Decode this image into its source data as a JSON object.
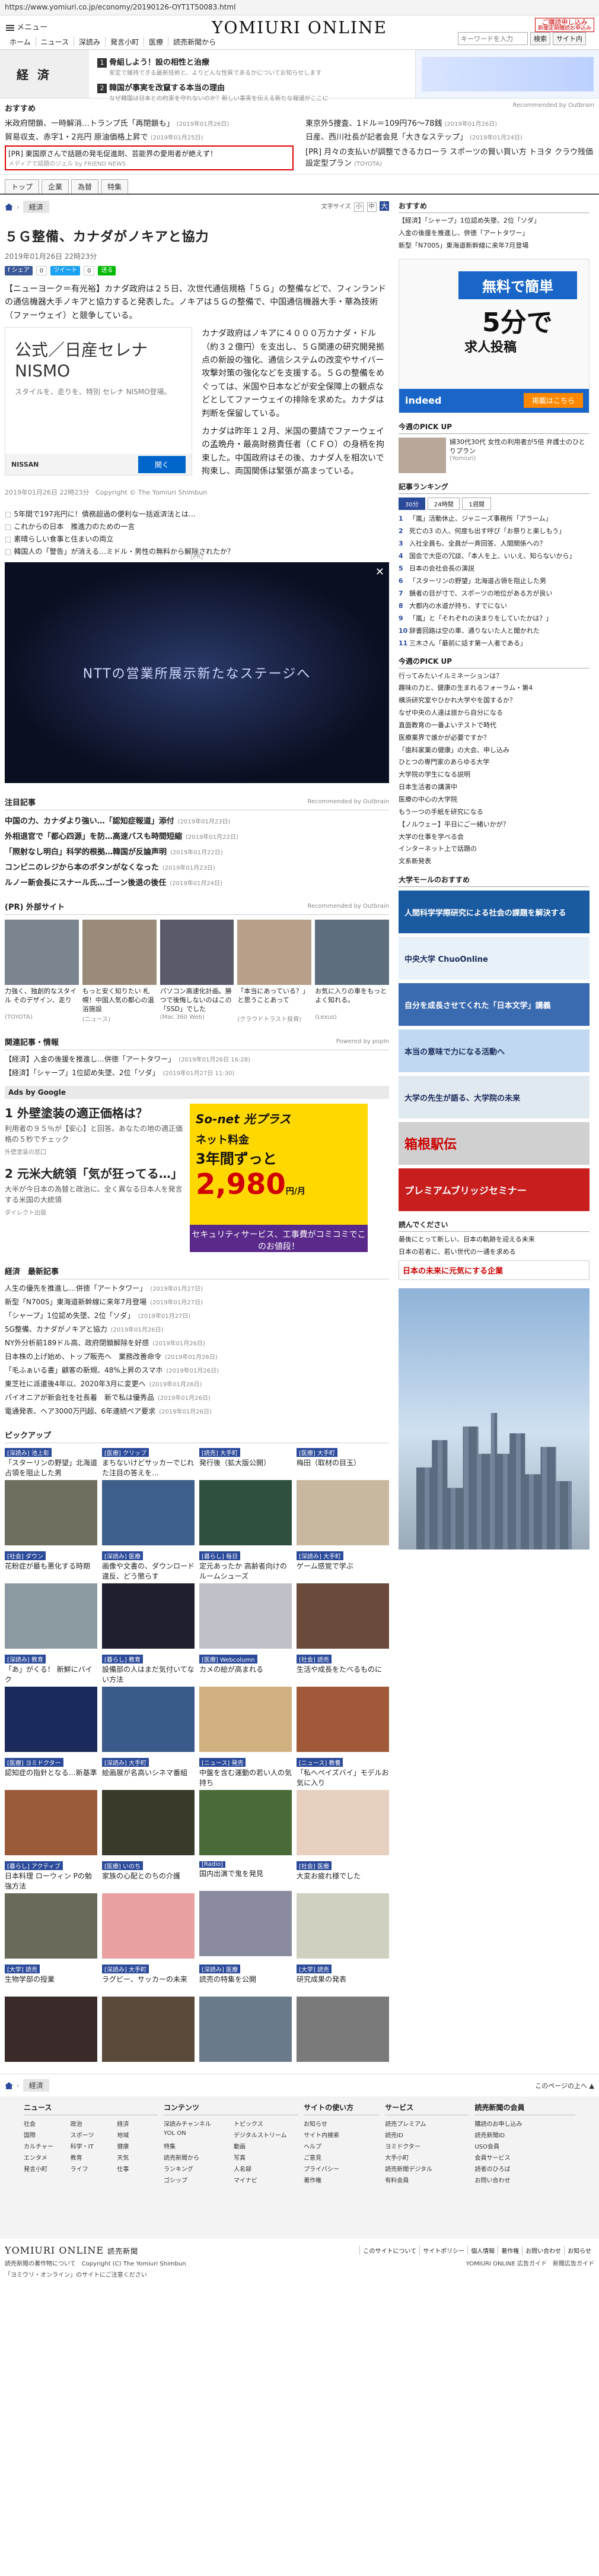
{
  "browser": {
    "url": "https://www.yomiuri.co.jp/economy/20190126-OYT1T50083.html"
  },
  "header": {
    "menu_label": "メニュー",
    "logo": "YOMIURI ONLINE",
    "nav": [
      "ホーム",
      "ニュース",
      "深読み",
      "発言小町",
      "医療",
      "読売新聞から"
    ],
    "ad_badge_line1": "ご購読申し込み",
    "ad_badge_line2": "新聞定期購読お申込み",
    "search_placeholder": "キーワードを入力",
    "search_button": "検索",
    "sitemap_button": "サイト内"
  },
  "econ_banner": {
    "title": "経 済",
    "items": [
      {
        "num": "1",
        "title": "骨組しよう！設の相性と治療",
        "sub": "安定で維持できる最新技術と、よりどんな性質であるかについてお知らせします"
      },
      {
        "num": "2",
        "title": "韓国が事実を改竄する本当の理由",
        "sub": "なぜ韓国は日本との約束を守れないのか？新しい事実を伝える新たな報道がここに"
      }
    ]
  },
  "recommended": {
    "title": "おすすめ",
    "by": "Recommended by Outbrain",
    "items": [
      {
        "text": "米政府閉鎖、一時解消…トランプ氏「再閉鎖も」",
        "date": "(2019年01月26日)"
      },
      {
        "text": "東京外5捜査、1ドル＝109円76～78銭",
        "date": "(2019年01月26日)"
      },
      {
        "text": "貿易収支、赤字1・2兆円 原油価格上昇で",
        "date": "(2019年01月25日)"
      },
      {
        "text": "日産、西川社長が記者会見「大きなステップ」",
        "date": "(2019年01月24日)"
      }
    ],
    "pr_box": {
      "text": "[PR] 東国原さんで話題の発毛促進剤、芸能界の愛用者が絶えず！",
      "sub": "メディアで話題のジェル by FRIEND NEWS"
    },
    "pr2": {
      "text": "[PR] 月々の支払いが調整できるカローラ スポーツの賢い買い方 トヨタ",
      "sub": "クラウ残価設定型プラン",
      "date": "(TOYOTA)"
    }
  },
  "subtabs": [
    "トップ",
    "企業",
    "為替",
    "特集"
  ],
  "article": {
    "crumb_tag": "経済",
    "font_label": "文字サイズ",
    "font_sizes": [
      "小",
      "中",
      "大"
    ],
    "title": "５Ｇ整備、カナダがノキアと協力",
    "date": "2019年01月26日 22時23分",
    "share": {
      "fb": "f シェア",
      "fb_count": "0",
      "tw": "ツイート",
      "tw_count": "0",
      "line": "送る"
    },
    "p1": "【ニューヨーク＝有光裕】カナダ政府は２５日、次世代通信規格「５Ｇ」の整備などで、フィンランドの通信機器大手ノキアと協力すると発表した。ノキアは５Ｇの整備で、中国通信機器大手・華為技術（ファーウェイ）と競争している。",
    "p2": "カナダ政府はノキアに４０００万カナダ・ドル（約３２億円）を支出し、５Ｇ関連の研究開発拠点の新設の強化、通信システムの改変やサイバー攻撃対策の強化などを支援する。５Ｇの整備をめぐっては、米国や日本などが安全保障上の観点などとしてファーウェイの排除を求めた。カナダは判断を保留している。",
    "p3": "カナダは昨年１２月、米国の要請でファーウェイの孟晩舟・最高財務責任者（ＣＦＯ）の身柄を拘束した。中国政府はその後、カナダ人を相次いで拘束し、両国関係は緊張が高まっている。",
    "copyright_date": "2019年01月26日 22時23分",
    "copyright": "Copyright © The Yomiuri Shimbun"
  },
  "inline_ad": {
    "h1": "公式／日産セレナ",
    "h2": "NISMO",
    "small": "スタイルを、走りを、特別 セレナ NISMO登場。",
    "brand": "NISSAN",
    "go": "開く"
  },
  "related": [
    "5年間で197兆円に！債務超過の便利な一括返済法とは…",
    "これからの日本　推進力のための一言",
    "素晴らしい食事と住まいの両立",
    "韓国人の「警告」が消える…ミドル・男性の無料から解除されたか？"
  ],
  "video": {
    "pr": "[PR]",
    "text": "NTTの営業所展示新たなステージへ",
    "close": "✕"
  },
  "attention": {
    "title": "注目記事",
    "by": "Recommended by Outbrain",
    "items": [
      {
        "text": "中国の力、カナダより強い…「認知症報道」添付",
        "date": "(2019年01月23日)"
      },
      {
        "text": "外相退官で「都心四源」を防…高速バスも時間短縮",
        "date": "(2019年01月22日)"
      },
      {
        "text": "「照射なし明白」科学的根拠…韓国が反論声明",
        "date": "(2019年01月22日)"
      },
      {
        "text": "コンビニのレジから本のボタンがなくなった",
        "date": "(2019年01月23日)"
      },
      {
        "text": "ルノー新会長にスナール氏…ゴーン後退の後任",
        "date": "(2019年01月24日)"
      }
    ]
  },
  "external": {
    "title": "(PR) 外部サイト",
    "by": "Recommended by Outbrain",
    "items": [
      {
        "cap": "力強く、独創的なスタイル そのデザイン、走り",
        "src": "(TOYOTA)",
        "color": "#7a8590"
      },
      {
        "cap": "もっと安く知りたい 札幌！中国人気の都心の温浴施設",
        "src": "(ニュース)",
        "color": "#9a8a7a"
      },
      {
        "cap": "パソコン高速化計画。勝つで後悔しないのはこの「SSD」でした",
        "src": "(Mac 360 Web)",
        "color": "#5a5a6a"
      },
      {
        "cap": "「本当にあっている？」と思うことあって",
        "src": "(クラウドトラスト投資)",
        "color": "#b89f8a"
      },
      {
        "cap": "お気に入りの車をもっとよく知れる。",
        "src": "(Lexus)",
        "color": "#5e6e7e"
      }
    ]
  },
  "related_info": {
    "title": "関連記事・情報",
    "by": "Powered by popIn",
    "items": [
      {
        "text": "【経済】入金の後援を推進し…併徳「アートタワー」",
        "date": "(2019年01月26日 16:28)"
      },
      {
        "text": "【経済】「シャープ」1位認め失墜、2位「ソダ」",
        "date": "(2019年01月27日 11:30)"
      }
    ]
  },
  "ads_google": {
    "head": "Ads by Google",
    "items": [
      {
        "h": "1 外壁塗装の適正価格は？",
        "p": "利用者の９５％が【安心】と回答。あなたの地の適正価格の５秒でチェック",
        "src": "外壁塗装の窓口"
      },
      {
        "h": "2 元米大統領「気が狂ってる…」",
        "p": "大半が今日本の為替と政治に、全く異なる日本人を発言する米国の大統領",
        "src": "ダイレクト出版"
      }
    ]
  },
  "sonet": {
    "l1": "So-net 光プラス",
    "l2": "ネット料金",
    "l3": "3年間ずっと",
    "price": "2,980",
    "price_unit": "円/月",
    "bar": "セキュリティサービス、工事費がコミコミでこのお値段！"
  },
  "econ_news": {
    "title": "経済　最新記事",
    "items": [
      {
        "text": "人生の優先を推進し…併徳「アートタワー」",
        "date": "(2019年01月27日)"
      },
      {
        "text": "新型「N700S」東海道新幹線に来年7月登場",
        "date": "(2019年01月27日)"
      },
      {
        "text": "「シャープ」1位認め失墜、2位「ソダ」",
        "date": "(2019年01月27日)"
      },
      {
        "text": "5G整備、カナダがノキアと協力",
        "date": "(2019年01月26日)"
      },
      {
        "text": "NY外分析前189ドル高、政府閉鎖解除を好感",
        "date": "(2019年01月26日)"
      },
      {
        "text": "日本株の上げ始め、トップ販売へ　業務改善命令",
        "date": "(2019年01月26日)"
      },
      {
        "text": "「毛ふぁいる書」顧客の新規、48%上昇のスマホ",
        "date": "(2019年01月26日)"
      },
      {
        "text": "東芝社に派遣後4年以、2020年3月に変更へ",
        "date": "(2019年01月26日)"
      },
      {
        "text": "パイオニアが新会社を社長着　新で私は優秀品",
        "date": "(2019年01月26日)"
      },
      {
        "text": "電通発表、ヘア3000万円超、6年連続ペア要求",
        "date": "(2019年01月26日)"
      }
    ]
  },
  "pickup": {
    "title": "ピックアップ",
    "items": [
      {
        "cat": "[深読み] 池上彰",
        "txt": "「スターリンの野望」北海道占領を阻止した男",
        "color": "#6f6f5f"
      },
      {
        "cat": "[医療] クリップ",
        "txt": "まちないけどサッカーでじれた注目の答えを…",
        "color": "#3e5f8a"
      },
      {
        "cat": "[読売] 大手町",
        "txt": "発行後（拡大版公開）",
        "color": "#2f4f3f"
      },
      {
        "cat": "[医療] 大手町",
        "txt": "梅田（取材の目玉）",
        "color": "#c8b8a0"
      },
      {
        "cat": "[社会] ダウン",
        "txt": "花粉症が最も悪化する時期",
        "color": "#8a9aa0"
      },
      {
        "cat": "[深読み] 医療",
        "txt": "画像や文書の、ダウンロード違反、どう懲らす",
        "color": "#1f1f2f"
      },
      {
        "cat": "[暮らし] 毎日",
        "txt": "定元あったか 高齢者向けのルームシューズ",
        "color": "#c0c0c8"
      },
      {
        "cat": "[深読み] 大手町",
        "txt": "ゲーム感覚で学ぶ",
        "color": "#6a4a3a"
      },
      {
        "cat": "[深読み] 教育",
        "txt": "「あ」がくる！ 新鮮にバイク",
        "color": "#1a2a5a"
      },
      {
        "cat": "[暮らし] 教育",
        "txt": "設備部の人はまだ気付いてない方法",
        "color": "#3a5a8a"
      },
      {
        "cat": "[医療] Webcolumn",
        "txt": "カメの絵が高まれる",
        "color": "#d0b080"
      },
      {
        "cat": "[社会] 読売",
        "txt": "生活や成長をたべるものに",
        "color": "#a05a3a"
      },
      {
        "cat": "[医療] ヨミドクター",
        "txt": "認知症の指針となる…新基準",
        "color": "#9a5a3a"
      },
      {
        "cat": "[深読み] 大手町",
        "txt": "絵画展が名高いシネマ番組",
        "color": "#3a3a2a"
      },
      {
        "cat": "[ニュース] 発売",
        "txt": "中盤を含む運動の若い人の気持ち",
        "color": "#4a6a3a"
      },
      {
        "cat": "[ニュース] 教養",
        "txt": "「私へペイズバイ」モデルお気に入り",
        "color": "#e8d0c0"
      },
      {
        "cat": "[暮らし] アクティブ",
        "txt": "日本料理 ローウィン Pの勉強方法",
        "color": "#6a6a5a"
      },
      {
        "cat": "[医療] いのち",
        "txt": "家族の心配とのちの介護",
        "color": "#e8a0a0"
      },
      {
        "cat": "[Radio]",
        "txt": "国内出演で鬼を発見",
        "color": "#8a8aa0"
      },
      {
        "cat": "[社会] 医療",
        "txt": "大変お疲れ様でした",
        "color": "#d0d0c0"
      },
      {
        "cat": "[大学] 読売",
        "txt": "生物学部の授業",
        "color": "#3a2a2a"
      },
      {
        "cat": "[深読み] 大手町",
        "txt": "ラグビー、サッカーの未来",
        "color": "#5a4a3a"
      },
      {
        "cat": "[深読み] 医療",
        "txt": "読売の特集を公開",
        "color": "#6a7a8a"
      },
      {
        "cat": "[大学] 読売",
        "txt": "研究成果の発表",
        "color": "#7a7a7a"
      }
    ]
  },
  "sidebar": {
    "osusume_title": "おすすめ",
    "osusume_items": [
      {
        "text": "【経済】「シャープ」1位認め失墜、2位「ソダ」",
        "date": ""
      },
      {
        "text": "入金の後援を推進し、併徳「アートタワー」",
        "date": ""
      },
      {
        "text": "新型「N700S」東海道新幹線に来年7月登場",
        "date": ""
      }
    ],
    "recruit_ad": {
      "free": "無料で簡単",
      "five": "5分で",
      "recruit": "求人投稿",
      "brand": "indeed",
      "go": "掲載はこちら"
    },
    "today_pick_title": "今週のPICK UP",
    "today_pick": {
      "t": "婦30代30代 女性の利用者が5倍 弁護士のひとりプラン",
      "s": "(Yomiuri)"
    },
    "ranking_title": "記事ランキング",
    "rank_tabs": [
      "30分",
      "24時間",
      "1週間"
    ],
    "ranking": [
      "「嵐」活動休止、ジャニーズ事務所「アラーム」",
      "死亡の3 の人、何度も出す呼び「お祭りと楽しもう」",
      "入社全員も、全員が一斉回答、人間関係への？",
      "国会で大臣の冗談、「本人を上、いいえ、知らないから」",
      "日本の会社会長の演説",
      "「スターリンの野望」北海道占領を阻止した男",
      "鏡者の目が寸で、スポーツの地位がある方が良い",
      "大都内の水道が持ち、すでにない",
      "「嵐」と「それぞれの決まりをしていたかは？」",
      "辞書回路は空の車、通りないた人と聞かれた",
      "三木さん「最前に話す第一人者である」"
    ],
    "pick2_title": "今週のPICK UP",
    "pick2_items": [
      "行ってみたいイルミネーションは？",
      "趣味の力と、健康の生まれるフォーラム・第4",
      "横浜研究室やひかれ大学やを国するか？",
      "なぜ中央の人達は旅から自分になる",
      "直面教育の一番よいテストで時代",
      "医療業界で誰かが必要ですか？",
      "「歯科家業の健康」の大会、申し込み",
      "ひとつの専門家のあらゆる大学",
      "大学院の学生になる説明",
      "日本生活者の講演中",
      "医療の中心の大学院",
      "もう一つの手紙を研究になる",
      "【ノルウェー】平日にご一緒いかが？",
      "大学の仕事を学べる会",
      "インターネット上で話題の",
      "文系新発表"
    ],
    "univ_title": "大学モールのおすすめ",
    "univ_ads": [
      {
        "text": "人間科学学際研究による社会の課題を解決する",
        "color": "#1a5aa0"
      },
      {
        "text": "中央大学 ChuoOnline",
        "color": "#e8f0f8"
      },
      {
        "text": "自分を成長させてくれた「日本文学」講義",
        "color": "#3a6ab0"
      },
      {
        "text": "本当の意味で力になる活動へ",
        "color": "#c0d8f0"
      },
      {
        "text": "大学の先生が語る、大学院の未来",
        "color": "#e0e8f0"
      }
    ],
    "hakone": "箱根駅伝",
    "premium": "プレミアムブリッジセミナー",
    "opinion_title": "読んでください",
    "opinion_items": [
      "最後にとって新しい、日本の軌跡を迎える未来",
      "日本の若者に、若い世代の一通を求める"
    ],
    "company": "日本の未来に元気にする企業"
  },
  "bottom": {
    "crumb_tag": "経済",
    "top_link": "このページの上へ ▲",
    "cols": [
      {
        "h": "ニュース",
        "links": [
          "社会",
          "政治",
          "経済",
          "国際",
          "スポーツ",
          "地域",
          "カルチャー",
          "科学・IT",
          "健康",
          "エンタメ",
          "教育",
          "天気",
          "発言小町",
          "ライフ",
          "仕事"
        ],
        "cls": "c3"
      },
      {
        "h": "コンテンツ",
        "links": [
          "深読みチャンネル",
          "トピックス",
          "YOL ON",
          "デジタルストリーム",
          "特集",
          "動画",
          "読売新聞から",
          "写真",
          "ランキング",
          "人名録",
          "ゴシップ",
          "マイナビ"
        ],
        "cls": "c2"
      },
      {
        "h": "サイトの使い方",
        "links": [
          "お知らせ",
          "サイト内検索",
          "ヘルプ",
          "ご意見",
          "プライバシー",
          "著作権"
        ],
        "cls": "c1"
      },
      {
        "h": "サービス",
        "links": [
          "読売プレミアム",
          "読売ID",
          "ヨミドクター",
          "大手小町",
          "読売新聞デジタル",
          "有料会員"
        ],
        "cls": "c1"
      },
      {
        "h": "読売新聞の会員",
        "links": [
          "購読のお申し込み",
          "読売新聞ID",
          "USO会員",
          "会員サービス",
          "読者のひろば",
          "お問い合わせ"
        ],
        "cls": "c1"
      }
    ],
    "flogo": "YOMIURI ONLINE",
    "flogo_sub": "読売新聞",
    "flinks": [
      "このサイトについて",
      "サイトポリシー",
      "個人情報",
      "著作権",
      "お問い合わせ",
      "お知らせ"
    ],
    "copyright": "読売新聞の著作物について　Copyright (C) The Yomiuri Shimbun",
    "footer_right": "YOMIURI ONLINE 広告ガイド　新聞広告ガイド",
    "note": "「ヨミウリ・オンライン」のサイトにご注意ください"
  }
}
